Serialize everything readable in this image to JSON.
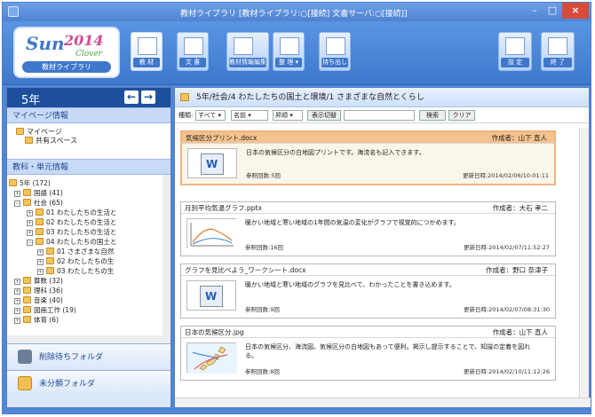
{
  "window": {
    "title": "教材ライブラリ [教材ライブラリ:○[接続] 文書サーバ:○[接続]]",
    "minimize": "–",
    "maximize": "□",
    "close": "×"
  },
  "toolbar": {
    "logo": {
      "sun": "Sun",
      "year": "2014",
      "sub": "Clover",
      "library": "教材ライブラリ"
    },
    "items": [
      {
        "label": "教 材",
        "icon": "books-icon",
        "active": true
      },
      {
        "label": "文 書",
        "icon": "documents-icon"
      },
      {
        "label": "教材情報編集",
        "icon": "edit-material-icon"
      },
      {
        "label": "整 理 ▾",
        "icon": "organize-icon"
      },
      {
        "label": "持ち出し",
        "icon": "export-icon"
      },
      {
        "label": "設 定",
        "icon": "settings-icon"
      },
      {
        "label": "終 了",
        "icon": "exit-icon"
      }
    ]
  },
  "sidebar": {
    "grade": "5年",
    "prev": "←",
    "next": "→",
    "mypage_title": "マイページ情報",
    "mypage_items": [
      "マイページ",
      "共有スペース"
    ],
    "subject_title": "教科・単元情報",
    "tree": [
      "5年 (172)",
      "国語 (41)",
      "社会 (65)",
      "01 わたしたちの生活と",
      "02 わたしたちの生活と",
      "03 わたしたちの生活と",
      "04 わたしたちの国土と",
      "01 さまざまな自然",
      "02 わたしたちの生",
      "03 わたしたちの生",
      "算数 (32)",
      "理科 (36)",
      "音楽 (40)",
      "図画工作 (19)",
      "体育 (6)"
    ],
    "trash": "削除待ちフォルダ",
    "unsorted": "未分類フォルダ"
  },
  "main": {
    "breadcrumb": "5年/社会/4 わたしたちの国土と環境/1 さまざまな自然とくらし",
    "filter": {
      "type_label": "種類:",
      "type": "すべて",
      "sort": "名前",
      "order": "昇順",
      "display": "表示切替",
      "search": "検索",
      "clear": "クリア"
    },
    "cards": [
      {
        "title": "気候区分プリント.docx",
        "author": "作成者：山下 直人",
        "description": "日本の気候区分の白地図プリントです。海流名も記入できます。",
        "refs": "参照回数:5回",
        "updated": "更新日時:2014/02/06/10:01:11"
      },
      {
        "title": "月別平均気温グラフ.pptx",
        "author": "作成者：大石 孝二",
        "description": "暖かい地域と寒い地域の1年間の気温の変化がグラフで視覚的につかめます。",
        "refs": "参照回数:16回",
        "updated": "更新日時:2014/02/07/11:52:27"
      },
      {
        "title": "グラフを見比べよう_ワークシート.docx",
        "author": "作成者：野口 奈津子",
        "description": "暖かい地域と寒い地域のグラフを見比べて、わかったことを書き込めます。",
        "refs": "参照回数:9回",
        "updated": "更新日時:2014/02/07/08:31:30"
      },
      {
        "title": "日本の気候区分.jpg",
        "author": "作成者：山下 直人",
        "description": "日本の気候区分、海流図、気候区分の白地図もあって便利。掲示し提示することで、知識の定着を図れる。",
        "refs": "参照回数:8回",
        "updated": "更新日時:2014/02/10/11:12:26"
      }
    ]
  }
}
